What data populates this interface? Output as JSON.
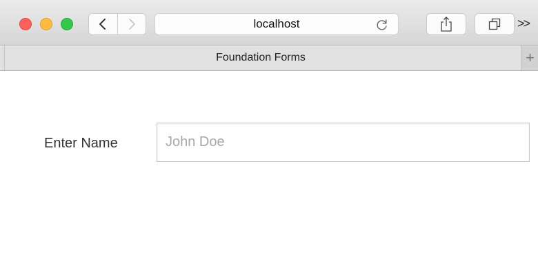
{
  "browser": {
    "url": "localhost",
    "overflow_label": ">>"
  },
  "tab": {
    "title": "Foundation Forms",
    "new_tab_label": "+"
  },
  "form": {
    "name_label": "Enter Name",
    "name_value": "",
    "name_placeholder": "John Doe"
  },
  "colors": {
    "close": "#fc605c",
    "minimize": "#fdbc40",
    "maximize": "#34c84a"
  },
  "icons": {
    "back": "chevron-left-icon",
    "forward": "chevron-right-icon",
    "reload": "reload-icon",
    "share": "share-icon",
    "tabs": "tabs-overview-icon"
  }
}
